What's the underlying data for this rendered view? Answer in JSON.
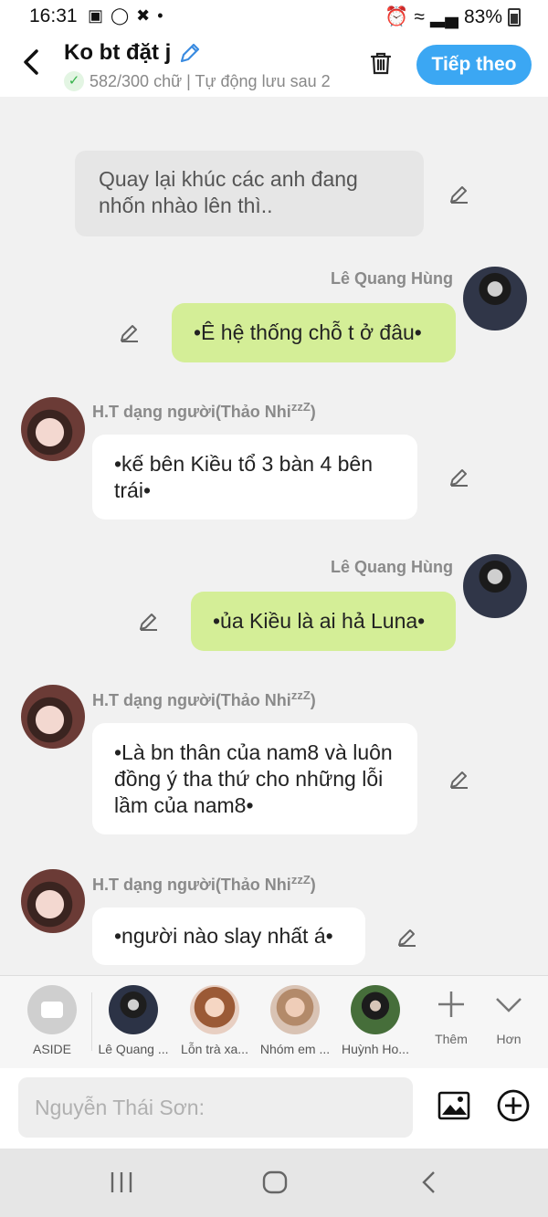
{
  "status": {
    "time": "16:31",
    "left_icons": [
      "gallery-icon",
      "instagram-icon",
      "capcut-icon",
      "dot-icon"
    ],
    "battery": "83%"
  },
  "header": {
    "title": "Ko bt đặt j",
    "subtitle": "582/300 chữ | Tự động lưu sau 2",
    "next_label": "Tiếp theo"
  },
  "messages": {
    "narration": "Quay lại khúc các anh đang nhốn nhào lên thì..",
    "m1": {
      "sender": "Lê Quang Hùng",
      "text": "•Ê hệ thống chỗ t ở đâu•"
    },
    "m2": {
      "sender": "H.T dạng người(Thảo Nhi",
      "text": "•kế bên Kiều  tổ 3 bàn 4 bên trái•"
    },
    "m3": {
      "sender": "Lê Quang Hùng",
      "text": "•ủa Kiều là ai hả Luna•"
    },
    "m4": {
      "sender": "H.T dạng người(Thảo Nhi",
      "text": "•Là bn thân của nam8 và luôn đồng ý tha thứ cho những lỗi lầm của nam8•"
    },
    "m5": {
      "sender": "H.T dạng người(Thảo Nhi",
      "text": "•người nào slay nhất á•"
    },
    "name_suffix_sub": "z",
    "name_suffix_sup": "z",
    "name_suffix_sup2": "Z",
    "name_close": ")"
  },
  "characters": [
    {
      "label": "ASIDE"
    },
    {
      "label": "Lê Quang ..."
    },
    {
      "label": "Lỗn trà xa..."
    },
    {
      "label": "Nhóm em ..."
    },
    {
      "label": "Huỳnh Ho..."
    }
  ],
  "actions": {
    "more_label": "Thêm",
    "less_label": "Hơn"
  },
  "input": {
    "placeholder": "Nguyễn Thái Sơn:"
  }
}
